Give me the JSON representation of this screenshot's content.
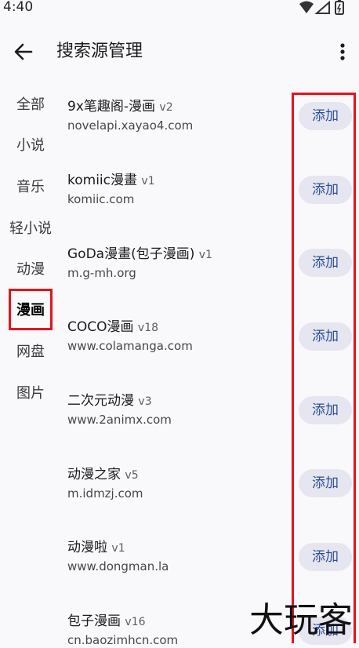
{
  "status": {
    "time": "4:40"
  },
  "header": {
    "title": "搜索源管理"
  },
  "sidebar": {
    "items": [
      {
        "label": "全部",
        "active": false
      },
      {
        "label": "小说",
        "active": false
      },
      {
        "label": "音乐",
        "active": false
      },
      {
        "label": "轻小说",
        "active": false
      },
      {
        "label": "动漫",
        "active": false
      },
      {
        "label": "漫画",
        "active": true
      },
      {
        "label": "网盘",
        "active": false
      },
      {
        "label": "图片",
        "active": false
      }
    ]
  },
  "sources": [
    {
      "name": "9x笔趣阁-漫画",
      "version": "v2",
      "url": "novelapi.xayao4.com",
      "action": "添加"
    },
    {
      "name": "komiic漫畫",
      "version": "v1",
      "url": "komiic.com",
      "action": "添加"
    },
    {
      "name": "GoDa漫畫(包子漫画)",
      "version": "v1",
      "url": "m.g-mh.org",
      "action": "添加"
    },
    {
      "name": "COCO漫画",
      "version": "v18",
      "url": "www.colamanga.com",
      "action": "添加"
    },
    {
      "name": "二次元动漫",
      "version": "v3",
      "url": "www.2animx.com",
      "action": "添加"
    },
    {
      "name": "动漫之家",
      "version": "v5",
      "url": "m.idmzj.com",
      "action": "添加"
    },
    {
      "name": "动漫啦",
      "version": "v1",
      "url": "www.dongman.la",
      "action": "添加"
    },
    {
      "name": "包子漫画",
      "version": "v16",
      "url": "cn.baozimhcn.com",
      "action": "添加"
    }
  ],
  "watermark": "大玩客",
  "colors": {
    "accent": "#2a4e94",
    "button_bg": "#e6e6f0",
    "highlight": "#e3141b",
    "background": "#f9f9fb"
  }
}
